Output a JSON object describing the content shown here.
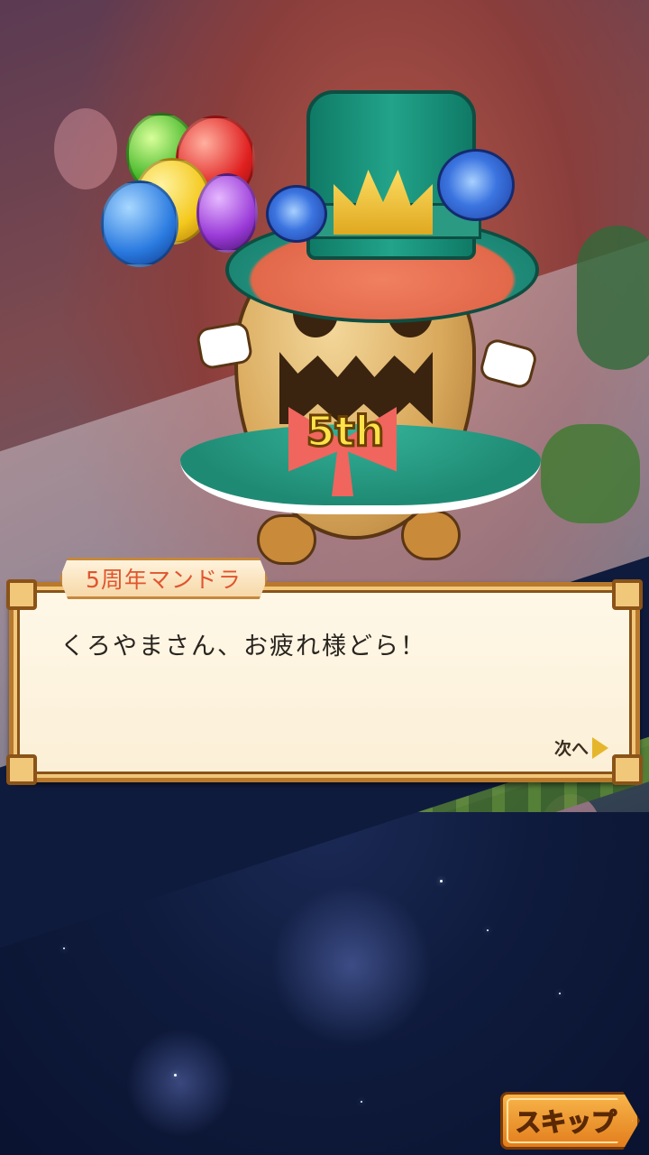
{
  "scene": {
    "name_tag": "5周年マンドラ",
    "dialog_text": "くろやまさん、お疲れ様どら！",
    "next_label": "次へ",
    "skip_label": "スキップ",
    "badge_text": "5th"
  },
  "icons": {
    "next": "triangle-right-icon",
    "skip": "arrow-button"
  },
  "colors": {
    "name_tag_text": "#e0552f",
    "dialog_border": "#b8792c",
    "skip_button": "#e27d1c",
    "night_sky": "#0f1b3d"
  }
}
